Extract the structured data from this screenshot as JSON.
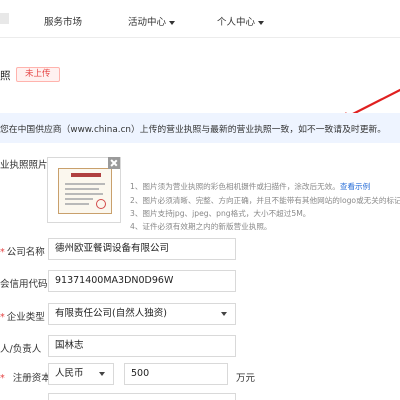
{
  "nav": {
    "items": [
      {
        "label": "服务市场"
      },
      {
        "label": "活动中心"
      },
      {
        "label": "个人中心"
      }
    ]
  },
  "title": {
    "label": "照",
    "status": "未上传"
  },
  "notice": {
    "text": "您在中国供应商（www.china.cn）上传的营业执照与最新的营业执照一致，如不一致请及时更新。"
  },
  "upload": {
    "label": "业执照照片",
    "hints": [
      {
        "text": "1、图片须为营业执照的彩色相机摄件或扫描件，涂改后无效。",
        "link": "查看示例"
      },
      {
        "text": "2、图片必须清晰、完整、方向正确，并且不能带有其他网站的logo或无关的标记信息"
      },
      {
        "text": "3、图片支持jpg、jpeg、png格式，大小不超过5M。"
      },
      {
        "text": "4、证件必须有效期之内的新版营业执照。"
      }
    ]
  },
  "form": {
    "company_name": {
      "label": "公司名称",
      "value": "德州欧亚餐调设备有限公司"
    },
    "credit_code": {
      "label": "会信用代码",
      "value": "91371400MA3DN0D96W"
    },
    "company_type": {
      "label": "企业类型",
      "value": "有限责任公司(自然人独资)"
    },
    "legal_person": {
      "label": "人/负责人",
      "value": "国林志"
    },
    "registered_capital": {
      "label": "注册资本",
      "currency": "人民币",
      "amount": "500",
      "unit": "万元"
    }
  },
  "colors": {
    "accent": "#2a6fd8",
    "required": "#e54545",
    "arrow": "#e02020",
    "notice_bg": "#eef4ff"
  }
}
